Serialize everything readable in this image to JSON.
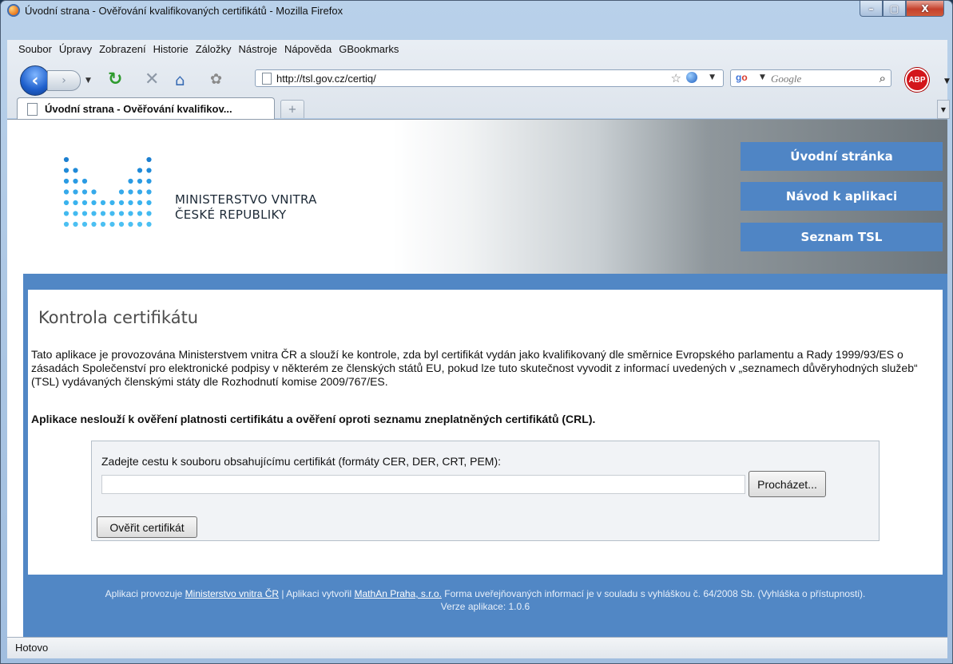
{
  "window": {
    "title": "Úvodní strana - Ověřování kvalifikovaných certifikátů - Mozilla Firefox",
    "minimize_glyph": "–",
    "maximize_glyph": "▢",
    "close_glyph": "X"
  },
  "menubar": {
    "items": [
      "Soubor",
      "Úpravy",
      "Zobrazení",
      "Historie",
      "Záložky",
      "Nástroje",
      "Nápověda",
      "GBookmarks"
    ]
  },
  "toolbar": {
    "url": "http://tsl.gov.cz/certiq/",
    "search_placeholder": "Google",
    "adblock_label": "ABP"
  },
  "tabs": [
    {
      "label": "Úvodní strana - Ověřování kvalifikov...",
      "active": true
    }
  ],
  "newtab_glyph": "+",
  "site": {
    "logo_lines": [
      "MINISTERSTVO VNITRA",
      "ČESKÉ REPUBLIKY"
    ],
    "nav": [
      "Úvodní stránka",
      "Návod k aplikaci",
      "Seznam TSL"
    ],
    "heading": "Kontrola certifikátu",
    "intro": "Tato aplikace je provozována Ministerstvem vnitra ČR a slouží ke kontrole, zda byl certifikát vydán jako kvalifikovaný dle směrnice Evropského parlamentu a Rady 1999/93/ES o zásadách Společenství pro elektronické podpisy v některém ze členských států EU, pokud lze tuto skutečnost vyvodit z informací uvedených v „seznamech důvěryhodných služeb“ (TSL) vydávaných členskými státy dle Rozhodnutí komise 2009/767/ES.",
    "warning": "Aplikace neslouží k ověření platnosti certifikátu a ověření oproti seznamu zneplatněných certifikátů (CRL).",
    "form": {
      "label": "Zadejte cestu k souboru obsahujícímu certifikát (formáty CER, DER, CRT, PEM):",
      "file_value": "",
      "browse_label": "Procházet...",
      "verify_label": "Ověřit certifikát"
    },
    "footer": {
      "prefix": "Aplikaci provozuje ",
      "link1": "Ministerstvo vnitra ČR",
      "middle": " | Aplikaci vytvořil ",
      "link2": "MathAn Praha, s.r.o.",
      "suffix": " Forma uveřejňovaných informací je v souladu s vyhláškou č. 64/2008 Sb. (Vyhláška o přístupnosti).",
      "version": "Verze aplikace: 1.0.6"
    }
  },
  "status": {
    "text": "Hotovo"
  },
  "colors": {
    "site_blue": "#5187c5",
    "nav_button": "#4f85c5"
  }
}
